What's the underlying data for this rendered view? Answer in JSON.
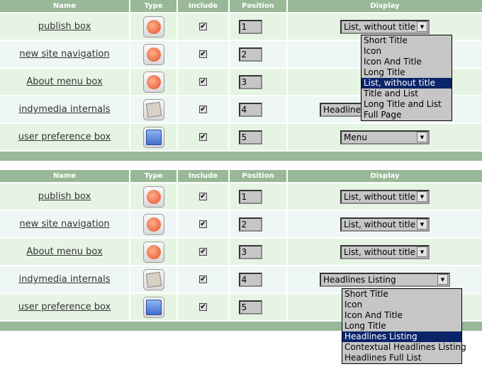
{
  "headers": [
    "Name",
    "Type",
    "Include",
    "Position",
    "Display"
  ],
  "table1": {
    "rows": [
      {
        "name": "publish box",
        "type": "publish",
        "include": true,
        "position": "1",
        "display": "List, without title"
      },
      {
        "name": "new site navigation",
        "type": "publish",
        "include": true,
        "position": "2",
        "display": ""
      },
      {
        "name": "About menu box",
        "type": "publish",
        "include": true,
        "position": "3",
        "display": ""
      },
      {
        "name": "indymedia internals",
        "type": "newswire",
        "include": true,
        "position": "4",
        "display": "Headlines Listing"
      },
      {
        "name": "user preference box",
        "type": "user",
        "include": true,
        "position": "5",
        "display": "Menu"
      }
    ],
    "dropdown": {
      "options": [
        "Short Title",
        "Icon",
        "Icon And Title",
        "Long Title",
        "List, without title",
        "Title and List",
        "Long Title and List",
        "Full Page"
      ],
      "selected": "List, without title"
    }
  },
  "table2": {
    "rows": [
      {
        "name": "publish box",
        "type": "publish",
        "include": true,
        "position": "1",
        "display": "List, without title"
      },
      {
        "name": "new site navigation",
        "type": "publish",
        "include": true,
        "position": "2",
        "display": "List, without title"
      },
      {
        "name": "About menu box",
        "type": "publish",
        "include": true,
        "position": "3",
        "display": "List, without title"
      },
      {
        "name": "indymedia internals",
        "type": "newswire",
        "include": true,
        "position": "4",
        "display": "Headlines Listing"
      },
      {
        "name": "user preference box",
        "type": "user",
        "include": true,
        "position": "5",
        "display": ""
      }
    ],
    "dropdown": {
      "options": [
        "Short Title",
        "Icon",
        "Icon And Title",
        "Long Title",
        "Headlines Listing",
        "Contextual Headlines Listing",
        "Headlines Full List"
      ],
      "selected": "Headlines Listing"
    }
  },
  "checkmark": "✔",
  "arrow": "▼"
}
